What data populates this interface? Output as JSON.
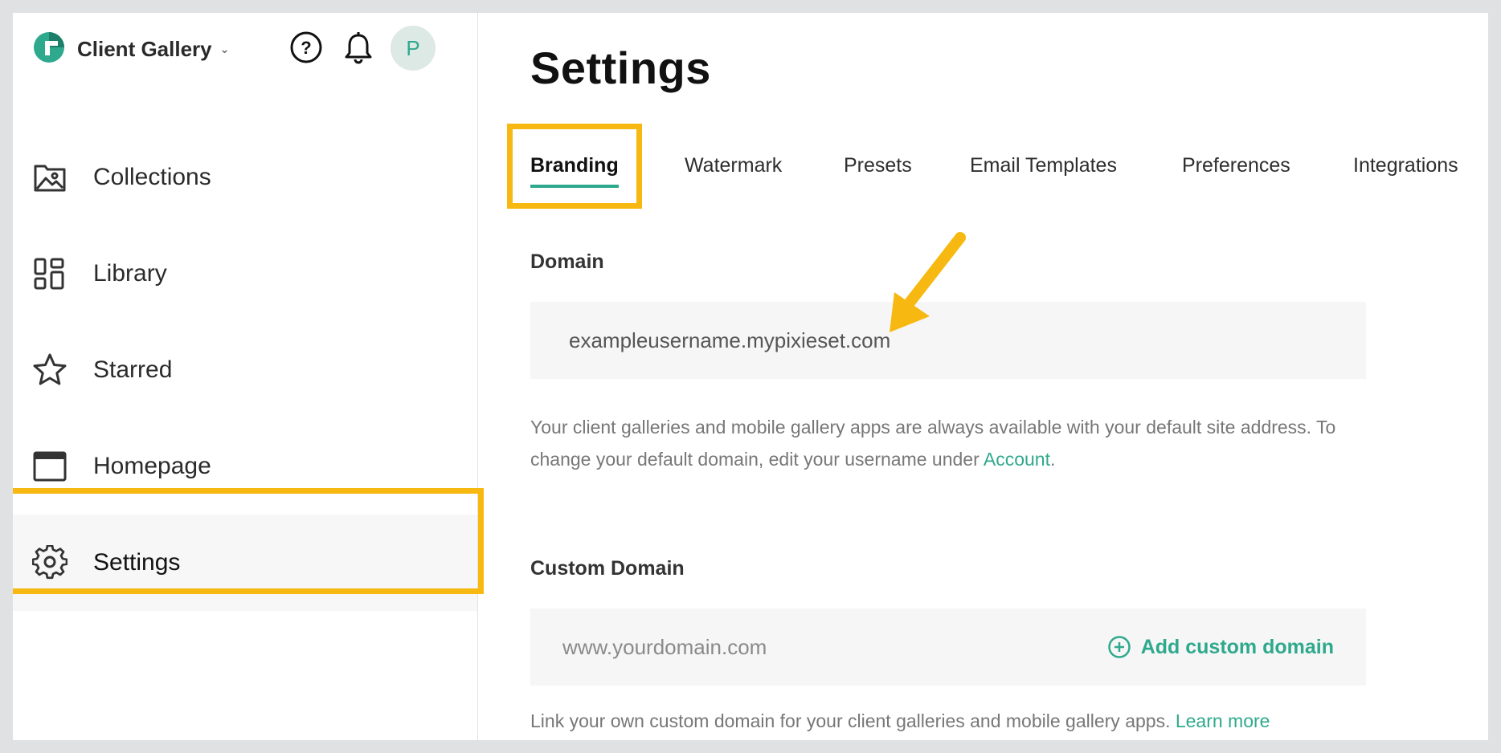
{
  "header": {
    "app_title": "Client Gallery",
    "avatar_initial": "P"
  },
  "sidebar": {
    "items": [
      {
        "label": "Collections",
        "icon": "image-icon"
      },
      {
        "label": "Library",
        "icon": "grid-icon"
      },
      {
        "label": "Starred",
        "icon": "star-icon"
      },
      {
        "label": "Homepage",
        "icon": "browser-window-icon"
      },
      {
        "label": "Settings",
        "icon": "gear-icon",
        "active": true
      }
    ]
  },
  "main": {
    "title": "Settings",
    "tabs": [
      {
        "label": "Branding",
        "active": true
      },
      {
        "label": "Watermark"
      },
      {
        "label": "Presets"
      },
      {
        "label": "Email Templates"
      },
      {
        "label": "Preferences"
      },
      {
        "label": "Integrations"
      }
    ],
    "domain": {
      "label": "Domain",
      "value": "exampleusername.mypixieset.com",
      "help_text": "Your client galleries and mobile gallery apps are always available with your default site address. To change your default domain, edit your username under ",
      "help_link": "Account",
      "help_suffix": "."
    },
    "custom_domain": {
      "label": "Custom Domain",
      "placeholder": "www.yourdomain.com",
      "add_button": "Add custom domain",
      "help_text": "Link your own custom domain for your client galleries and mobile gallery apps. ",
      "help_link": "Learn more"
    }
  },
  "colors": {
    "accent": "#2fa98d",
    "highlight": "#f7b911",
    "field_bg": "#f6f6f6"
  }
}
